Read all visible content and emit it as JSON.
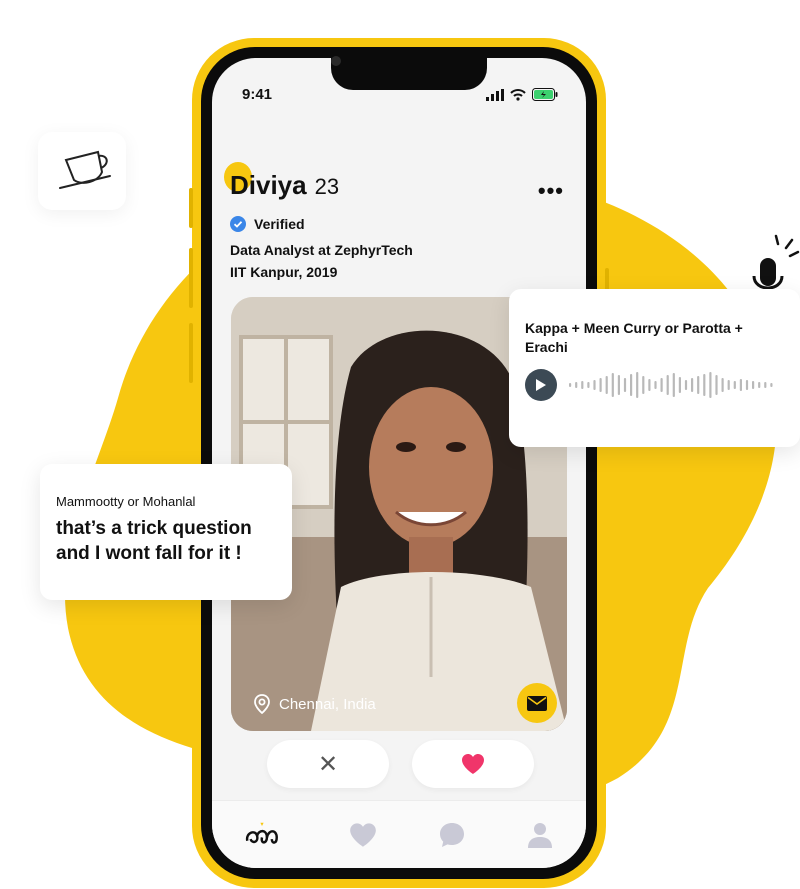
{
  "status_bar": {
    "time": "9:41"
  },
  "profile": {
    "name": "Diviya",
    "age": "23",
    "verified_label": "Verified",
    "job": "Data Analyst at ZephyrTech",
    "education": "IIT Kanpur, 2019",
    "location": "Chennai, India"
  },
  "actions": {
    "reject_symbol": "✕"
  },
  "voice_prompt": {
    "text": "Kappa + Meen Curry or Parotta + Erachi"
  },
  "quote_prompt": {
    "question": "Mammootty or Mohanlal",
    "answer": "that’s a trick question and I wont fall for it !"
  },
  "colors": {
    "accent": "#f7c710",
    "heart": "#f0356a",
    "verified_blue": "#3a86e8",
    "tab_inactive": "#c9c9d6"
  },
  "icons": {
    "menu": "more-dots-icon",
    "location": "location-pin-icon",
    "message": "mail-icon",
    "like": "heart-icon",
    "reject": "close-icon",
    "play": "play-icon",
    "mic": "microphone-icon",
    "cup": "tea-cup-icon"
  }
}
